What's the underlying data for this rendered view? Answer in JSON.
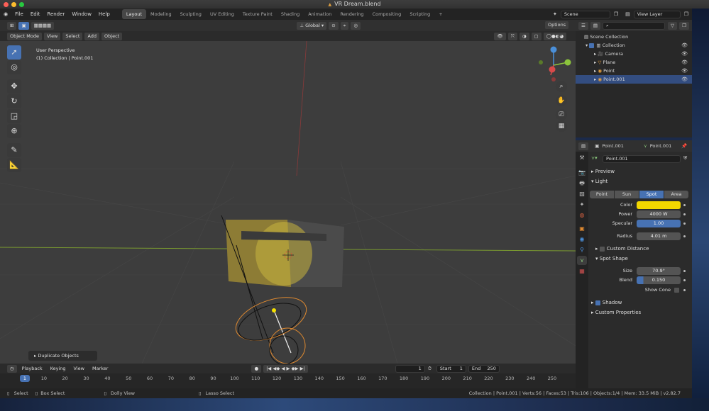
{
  "window": {
    "title": "VR Dream.blend"
  },
  "menu": [
    "File",
    "Edit",
    "Render",
    "Window",
    "Help"
  ],
  "workspaces": [
    "Layout",
    "Modeling",
    "Sculpting",
    "UV Editing",
    "Texture Paint",
    "Shading",
    "Animation",
    "Rendering",
    "Compositing",
    "Scripting"
  ],
  "scene_name": "Scene",
  "view_layer": "View Layer",
  "viewport_header": {
    "mode": "Object Mode",
    "menus": [
      "View",
      "Select",
      "Add",
      "Object"
    ],
    "orientation": "Global",
    "options": "Options"
  },
  "viewport": {
    "perspective": "User Perspective",
    "collection_info": "(1) Collection | Point.001",
    "last_op": "Duplicate Objects"
  },
  "timeline": {
    "menus": [
      "Playback",
      "Keying",
      "View",
      "Marker"
    ],
    "current_frame": "1",
    "start_label": "Start",
    "start": "1",
    "end_label": "End",
    "end": "250",
    "cur": "1",
    "ticks": [
      "10",
      "20",
      "30",
      "40",
      "50",
      "60",
      "70",
      "80",
      "90",
      "100",
      "110",
      "120",
      "130",
      "140",
      "150",
      "160",
      "170",
      "180",
      "190",
      "200",
      "210",
      "220",
      "230",
      "240",
      "250"
    ]
  },
  "status": {
    "select": "Select",
    "box_select": "Box Select",
    "dolly": "Dolly View",
    "lasso": "Lasso Select",
    "info": "Collection | Point.001 | Verts:56 | Faces:53 | Tris:106 | Objects:1/4 | Mem: 33.5 MiB | v2.82.7"
  },
  "outliner": {
    "scene_collection": "Scene Collection",
    "items": [
      {
        "label": "Collection"
      },
      {
        "label": "Camera"
      },
      {
        "label": "Plane"
      },
      {
        "label": "Point"
      },
      {
        "label": "Point.001"
      }
    ]
  },
  "properties": {
    "object": "Point.001",
    "data": "Point.001",
    "datablock": "Point.001",
    "preview": "Preview",
    "light": "Light",
    "types": [
      "Point",
      "Sun",
      "Spot",
      "Area"
    ],
    "active_type": "Spot",
    "color_label": "Color",
    "color": "#f2d600",
    "power_label": "Power",
    "power": "4000 W",
    "specular_label": "Specular",
    "specular": "1.00",
    "radius_label": "Radius",
    "radius": "4.01 m",
    "custom_distance": "Custom Distance",
    "spot_shape": "Spot Shape",
    "size_label": "Size",
    "size": "70.9°",
    "blend_label": "Blend",
    "blend": "0.150",
    "show_cone": "Show Cone",
    "shadow": "Shadow",
    "custom_properties": "Custom Properties"
  }
}
